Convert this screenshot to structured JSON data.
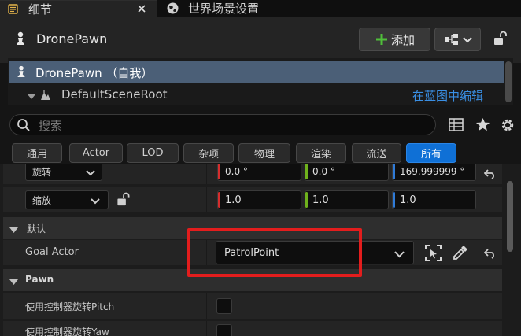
{
  "tabs": [
    {
      "label": "细节",
      "icon": "details-icon"
    },
    {
      "label": "世界场景设置",
      "icon": "world-icon"
    }
  ],
  "header": {
    "actor_name": "DronePawn",
    "add_label": "添加"
  },
  "tree": {
    "root_label": "DronePawn （自我）",
    "child_label": "DefaultSceneRoot",
    "edit_in_blueprint": "在蓝图中编辑"
  },
  "search": {
    "placeholder": "搜索"
  },
  "filters": [
    "通用",
    "Actor",
    "LOD",
    "杂项",
    "物理",
    "渲染",
    "流送",
    "所有"
  ],
  "transform": {
    "rotation_label": "旋转",
    "rotation": [
      "0.0 °",
      "0.0 °",
      "169.999999 °"
    ],
    "scale_label": "缩放",
    "scale": [
      "1.0",
      "1.0",
      "1.0"
    ]
  },
  "default_section": {
    "title": "默认",
    "goal_actor_label": "Goal Actor",
    "goal_actor_value": "PatrolPoint"
  },
  "pawn_section": {
    "title": "Pawn",
    "use_pitch_label": "使用控制器旋转Pitch",
    "use_yaw_label": "使用控制器旋转Yaw"
  },
  "colors": {
    "accent": "#0f70d6",
    "selection": "#4b5f77",
    "highlight_box": "#e31d1d",
    "x_axis": "#d52d2d",
    "y_axis": "#6fb11c",
    "z_axis": "#2f7bd8"
  }
}
